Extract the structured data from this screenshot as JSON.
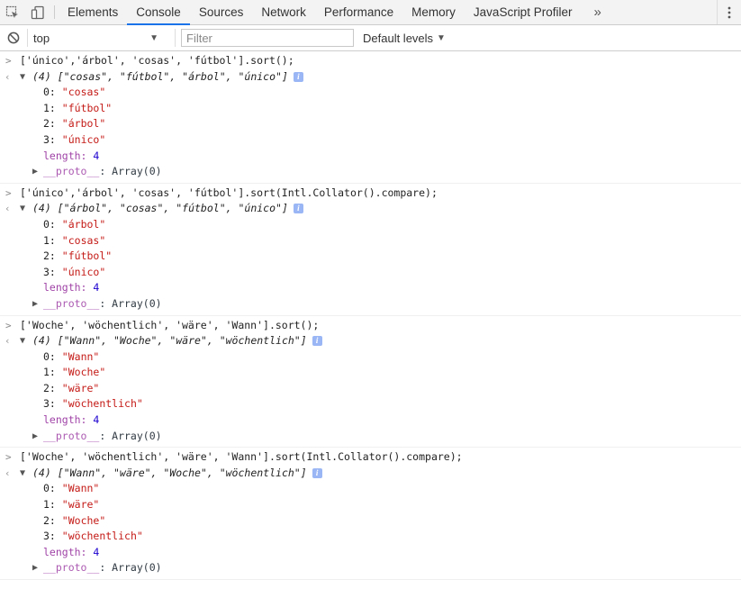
{
  "tabs": [
    "Elements",
    "Console",
    "Sources",
    "Network",
    "Performance",
    "Memory",
    "JavaScript Profiler"
  ],
  "active_tab": "Console",
  "more_tabs_glyph": "»",
  "toolbar": {
    "context": "top",
    "filter_placeholder": "Filter",
    "levels": "Default levels"
  },
  "icons": {
    "inspect": "inspect-element-icon",
    "device": "device-toolbar-icon",
    "clear": "clear-console-icon",
    "menu": "kebab-menu-icon",
    "info": "info-icon"
  },
  "entries": [
    {
      "input": "['único','árbol', 'cosas', 'fútbol'].sort();",
      "summary": "(4) [\"cosas\", \"fútbol\", \"árbol\", \"único\"]",
      "items": [
        {
          "key": "0:",
          "value": "\"cosas\""
        },
        {
          "key": "1:",
          "value": "\"fútbol\""
        },
        {
          "key": "2:",
          "value": "\"árbol\""
        },
        {
          "key": "3:",
          "value": "\"único\""
        }
      ],
      "length_label": "length:",
      "length_value": "4",
      "proto_label": "__proto__",
      "proto_value": ": Array(0)"
    },
    {
      "input": "['único','árbol', 'cosas', 'fútbol'].sort(Intl.Collator().compare);",
      "summary": "(4) [\"árbol\", \"cosas\", \"fútbol\", \"único\"]",
      "items": [
        {
          "key": "0:",
          "value": "\"árbol\""
        },
        {
          "key": "1:",
          "value": "\"cosas\""
        },
        {
          "key": "2:",
          "value": "\"fútbol\""
        },
        {
          "key": "3:",
          "value": "\"único\""
        }
      ],
      "length_label": "length:",
      "length_value": "4",
      "proto_label": "__proto__",
      "proto_value": ": Array(0)"
    },
    {
      "input": "['Woche', 'wöchentlich', 'wäre', 'Wann'].sort();",
      "summary": "(4) [\"Wann\", \"Woche\", \"wäre\", \"wöchentlich\"]",
      "items": [
        {
          "key": "0:",
          "value": "\"Wann\""
        },
        {
          "key": "1:",
          "value": "\"Woche\""
        },
        {
          "key": "2:",
          "value": "\"wäre\""
        },
        {
          "key": "3:",
          "value": "\"wöchentlich\""
        }
      ],
      "length_label": "length:",
      "length_value": "4",
      "proto_label": "__proto__",
      "proto_value": ": Array(0)"
    },
    {
      "input": "['Woche', 'wöchentlich', 'wäre', 'Wann'].sort(Intl.Collator().compare);",
      "summary": "(4) [\"Wann\", \"wäre\", \"Woche\", \"wöchentlich\"]",
      "items": [
        {
          "key": "0:",
          "value": "\"Wann\""
        },
        {
          "key": "1:",
          "value": "\"wäre\""
        },
        {
          "key": "2:",
          "value": "\"Woche\""
        },
        {
          "key": "3:",
          "value": "\"wöchentlich\""
        }
      ],
      "length_label": "length:",
      "length_value": "4",
      "proto_label": "__proto__",
      "proto_value": ": Array(0)"
    }
  ]
}
